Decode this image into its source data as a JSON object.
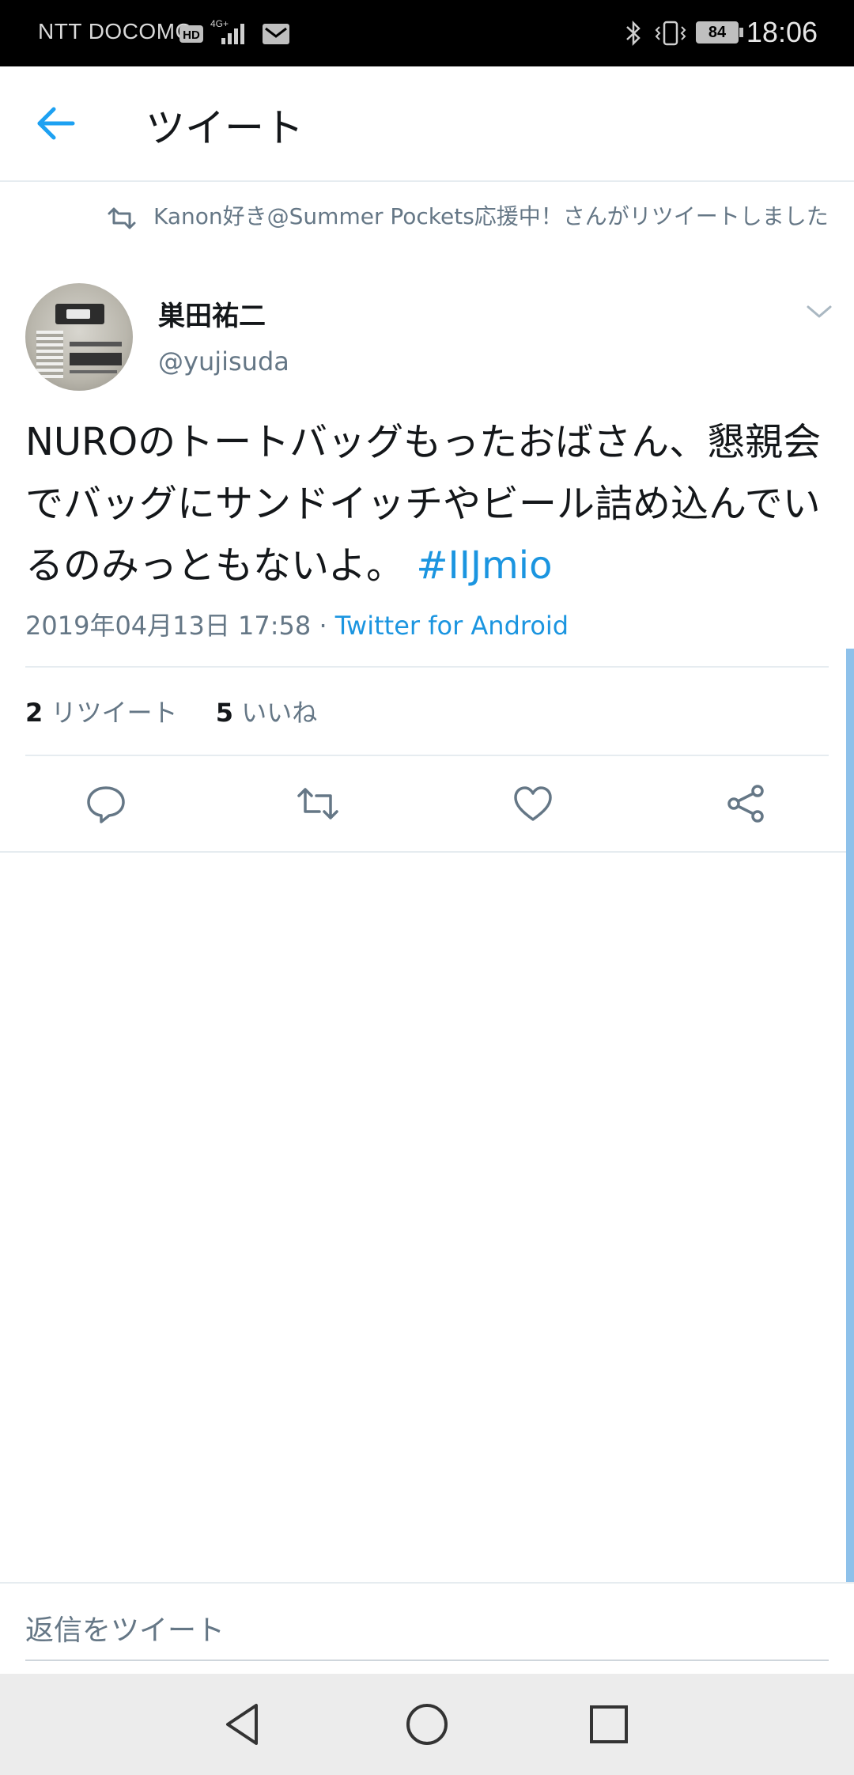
{
  "status_bar": {
    "carrier": "NTT DOCOMO",
    "hd_badge": "HD",
    "network": "4G+",
    "battery": "84",
    "time": "18:06"
  },
  "header": {
    "title": "ツイート"
  },
  "retweet_context": {
    "text": "Kanon好き@Summer Pockets応援中！さんがリツイートしました"
  },
  "author": {
    "name": "巣田祐二",
    "handle": "@yujisuda"
  },
  "tweet": {
    "text": "NUROのトートバッグもったおばさん、懇親会でバッグにサンドイッチやビール詰め込んでいるのみっともないよ。",
    "hashtag": "#IIJmio",
    "timestamp": "2019年04月13日 17:58",
    "separator": "·",
    "source": "Twitter for Android"
  },
  "stats": {
    "retweet_count": "2",
    "retweet_label": "リツイート",
    "like_count": "5",
    "like_label": "いいね"
  },
  "actions": [
    "reply-icon",
    "retweet-icon",
    "like-icon",
    "share-icon"
  ],
  "reply": {
    "placeholder": "返信をツイート"
  },
  "colors": {
    "accent": "#1b95e0",
    "secondary_text": "#657786",
    "divider": "#e6ecf0"
  }
}
